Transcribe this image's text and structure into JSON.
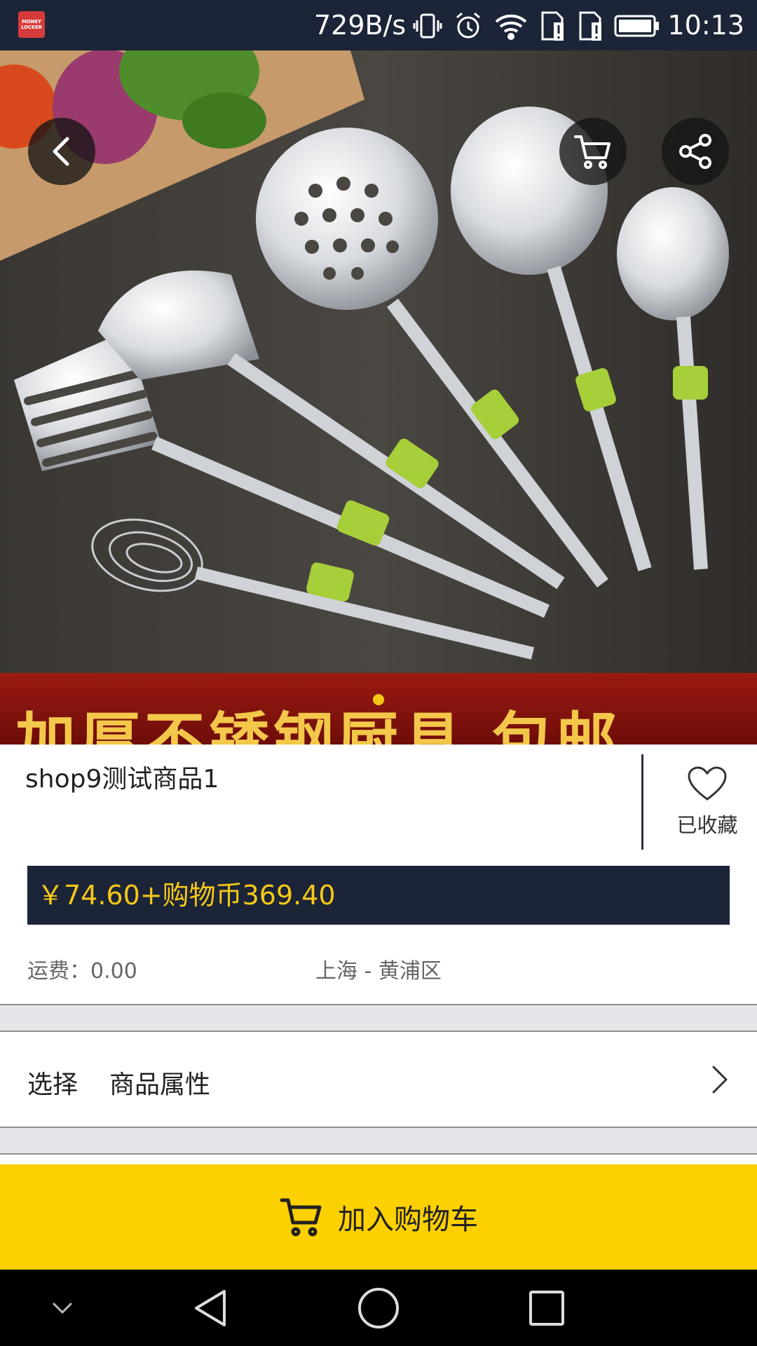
{
  "status_bar": {
    "app_logo_text": "MONEY LOCKER",
    "net_speed": "729B/s",
    "time": "10:13",
    "icons": [
      "vibrate-icon",
      "alarm-icon",
      "wifi-icon",
      "sim1-alert-icon",
      "sim2-alert-icon",
      "battery-icon"
    ]
  },
  "header": {
    "back_icon": "back-arrow-icon",
    "cart_icon": "cart-icon",
    "share_icon": "share-icon"
  },
  "hero": {
    "banner_text": "加厚不锈钢厨具 包邮",
    "pager": {
      "current": 1,
      "total": 1
    }
  },
  "product": {
    "title": "shop9测试商品1",
    "favorite_label": "已收藏",
    "price_text": "￥74.60+购物币369.40",
    "shipping_text": "运费：0.00",
    "location": "上海 - 黄浦区"
  },
  "attributes": {
    "select_label": "选择",
    "name": "商品属性"
  },
  "actions": {
    "add_to_cart_label": "加入购物车"
  },
  "nav": {
    "items": [
      "collapse-icon",
      "back-icon",
      "home-icon",
      "recents-icon"
    ]
  },
  "colors": {
    "navy": "#1c2438",
    "accent_yellow": "#fdd000",
    "price_yellow": "#f5c817"
  }
}
